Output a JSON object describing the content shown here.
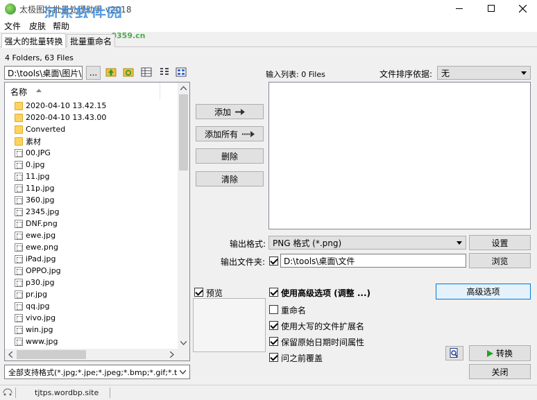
{
  "window": {
    "title": "太极图片批量处理助手 v2018",
    "watermark": "河东软件园",
    "watermark_url": "www.pc0359.cn"
  },
  "menu": [
    "文件",
    "皮肤",
    "帮助"
  ],
  "tabs": [
    "强大的批量转换",
    "批量重命名"
  ],
  "folder_summary": "4 Folders, 63 Files",
  "path": "D:\\tools\\桌面\\图片\\",
  "browse_label": "...",
  "list_header": "名称",
  "files": [
    {
      "name": "2020-04-10 13.42.15",
      "type": "folder"
    },
    {
      "name": "2020-04-10 13.43.00",
      "type": "folder"
    },
    {
      "name": "Converted",
      "type": "folder"
    },
    {
      "name": "素材",
      "type": "folder"
    },
    {
      "name": "00.JPG",
      "type": "image"
    },
    {
      "name": "0.jpg",
      "type": "image"
    },
    {
      "name": "11.jpg",
      "type": "image"
    },
    {
      "name": "11p.jpg",
      "type": "image"
    },
    {
      "name": "360.jpg",
      "type": "image"
    },
    {
      "name": "2345.jpg",
      "type": "image"
    },
    {
      "name": "DNF.png",
      "type": "image"
    },
    {
      "name": "ewe.jpg",
      "type": "image"
    },
    {
      "name": "ewe.png",
      "type": "image"
    },
    {
      "name": "iPad.jpg",
      "type": "image"
    },
    {
      "name": "OPPO.jpg",
      "type": "image"
    },
    {
      "name": "p30.jpg",
      "type": "image"
    },
    {
      "name": "pr.jpg",
      "type": "image"
    },
    {
      "name": "qq.jpg",
      "type": "image"
    },
    {
      "name": "vivo.jpg",
      "type": "image"
    },
    {
      "name": "win.jpg",
      "type": "image"
    },
    {
      "name": "www.jpg",
      "type": "image"
    }
  ],
  "filter": "全部支持格式(*.jpg;*.jpe;*.jpeg;*.bmp;*.gif;*.t",
  "actions": {
    "add": "添加",
    "add_all": "添加所有",
    "delete": "删除",
    "clear": "清除"
  },
  "input_list_label": "输入列表: 0 Files",
  "sort_label": "文件排序依据:",
  "sort_value": "无",
  "output_format_label": "输出格式:",
  "output_format_value": "PNG 格式 (*.png)",
  "settings_label": "设置",
  "output_folder_label": "输出文件夹:",
  "output_folder_value": "D:\\tools\\桌面\\文件",
  "browse2_label": "浏览",
  "preview_label": "预览",
  "options": {
    "advanced": "使用高级选项 (调整 ...)",
    "rename": "重命名",
    "uppercase_ext": "使用大写的文件扩展名",
    "keep_date": "保留原始日期时间属性",
    "overwrite": "问之前覆盖"
  },
  "advanced_button": "高级选项",
  "convert_label": "转换",
  "close_label": "关闭",
  "status_text": "tjtps.wordbp.site"
}
